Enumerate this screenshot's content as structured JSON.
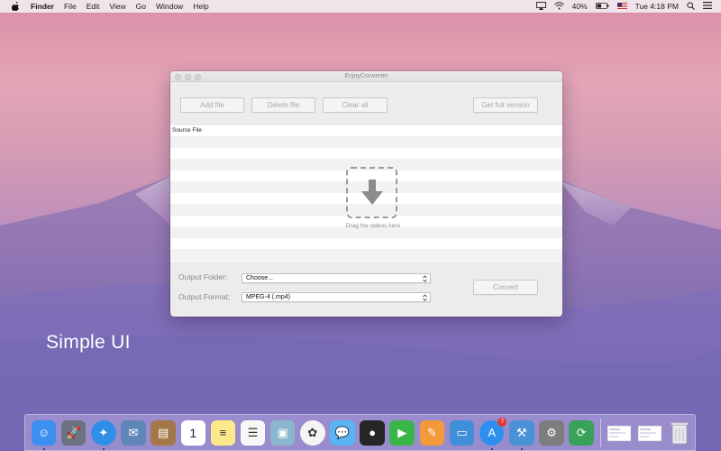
{
  "menubar": {
    "app_name": "Finder",
    "items": [
      "File",
      "Edit",
      "View",
      "Go",
      "Window",
      "Help"
    ],
    "battery": "40%",
    "clock": "Tue 4:18 PM"
  },
  "window": {
    "title": "EnjoyConverter",
    "buttons": {
      "add_file": "Add file",
      "delete_file": "Delete file",
      "clear_all": "Clear all",
      "get_full": "Get full version",
      "convert": "Convert"
    },
    "list": {
      "header": "Source File",
      "drop_hint": "Drag the videos here"
    },
    "output_folder": {
      "label": "Output  Folder:",
      "value": "Choose..."
    },
    "output_format": {
      "label": "Output Format:",
      "value": "MPEG-4 (.mp4)"
    }
  },
  "slogan": "Simple UI",
  "dock": {
    "items": [
      {
        "icon": "finder-icon",
        "color": "#3d8ff0"
      },
      {
        "icon": "launchpad-icon",
        "color": "#6c7380"
      },
      {
        "icon": "safari-icon",
        "color": "#2f8fe8"
      },
      {
        "icon": "mail-icon",
        "color": "#5f86b8"
      },
      {
        "icon": "contacts-icon",
        "color": "#a47748"
      },
      {
        "icon": "calendar-icon",
        "color": "#ffffff",
        "text": "1"
      },
      {
        "icon": "notes-icon",
        "color": "#fbe98c"
      },
      {
        "icon": "reminders-icon",
        "color": "#f7f7f7"
      },
      {
        "icon": "preview-icon",
        "color": "#8bb6cf"
      },
      {
        "icon": "photos-icon",
        "color": "#f4f4f4"
      },
      {
        "icon": "messages-icon",
        "color": "#5ab3f2"
      },
      {
        "icon": "qq-icon",
        "color": "#262626"
      },
      {
        "icon": "facetime-icon",
        "color": "#39b54a"
      },
      {
        "icon": "pages-icon",
        "color": "#f29a3b"
      },
      {
        "icon": "keynote-icon",
        "color": "#3f8fd9"
      },
      {
        "icon": "app-store-icon",
        "color": "#2d8ff0",
        "badge": "7"
      },
      {
        "icon": "xcode-icon",
        "color": "#4a92d6"
      },
      {
        "icon": "system-preferences-icon",
        "color": "#7d7d7d"
      },
      {
        "icon": "converter-icon",
        "color": "#3aa15a"
      }
    ],
    "docs": [
      {
        "icon": "document-stack-icon"
      },
      {
        "icon": "screenshot-stack-icon"
      },
      {
        "icon": "trash-icon"
      }
    ]
  }
}
